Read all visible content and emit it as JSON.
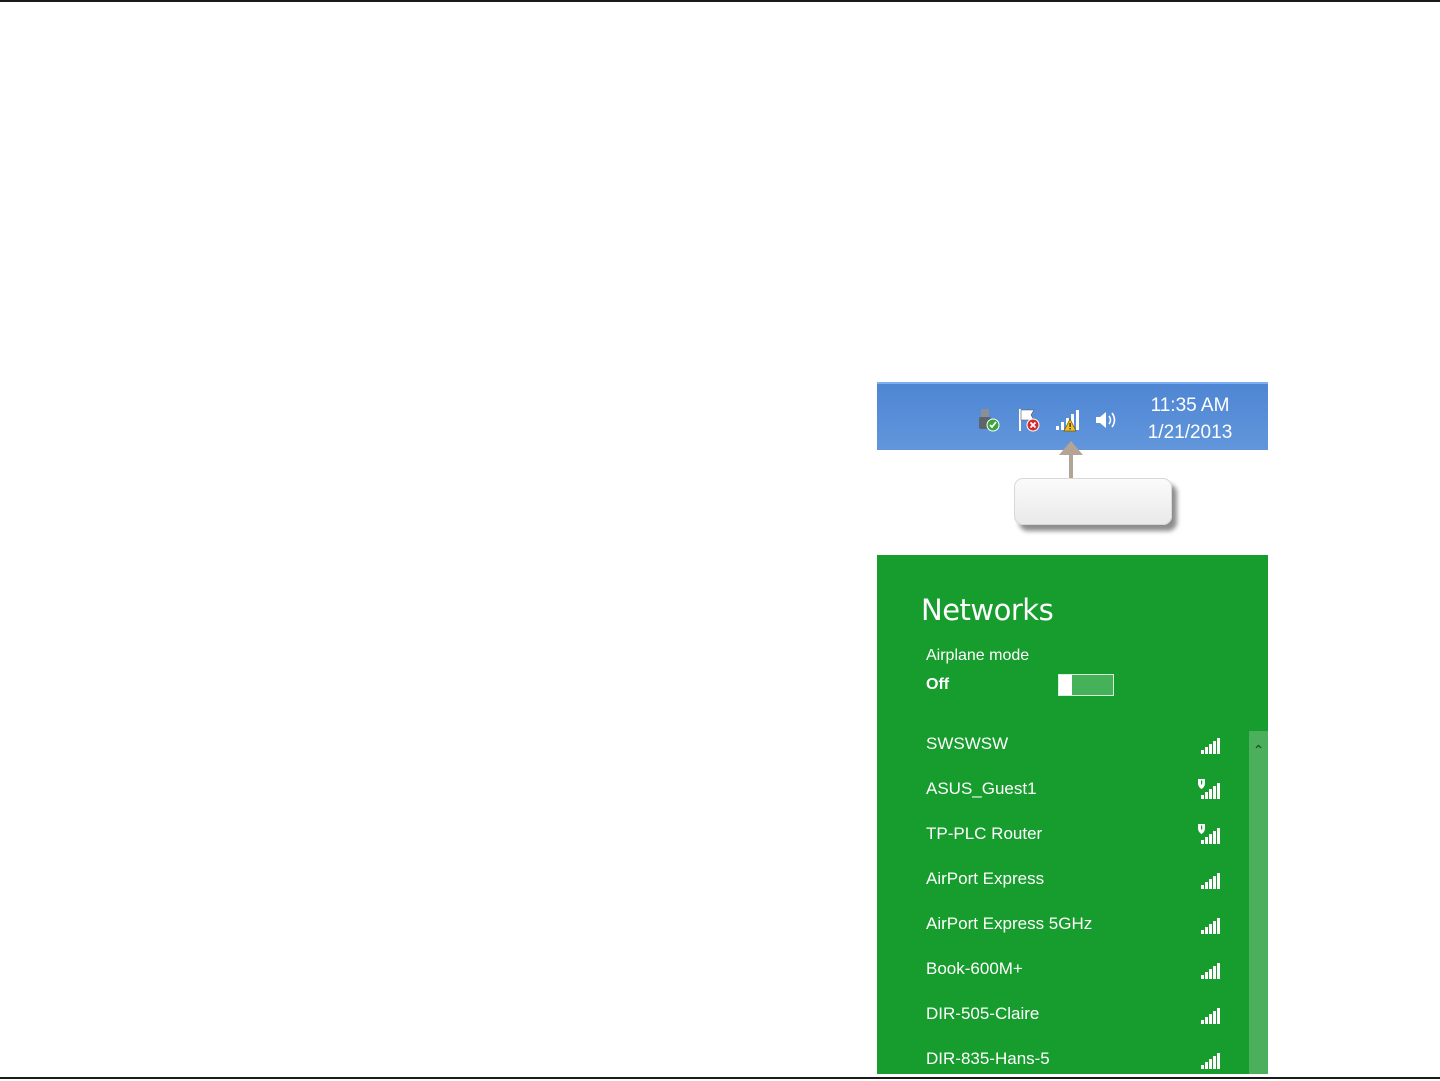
{
  "taskbar": {
    "time": "11:35 AM",
    "date": "1/21/2013",
    "tray_icons": [
      "usb-safe-remove-icon",
      "action-center-flag-icon",
      "wireless-network-warning-icon",
      "speaker-volume-icon"
    ]
  },
  "colors": {
    "taskbar_blue": "#5b8fd6",
    "panel_green": "#179c2e",
    "callout_arrow": "#b3a496"
  },
  "networks_panel": {
    "title": "Networks",
    "airplane_mode_label": "Airplane mode",
    "airplane_mode_state": "Off",
    "networks": [
      {
        "name": "SWSWSW",
        "secured_shield": false
      },
      {
        "name": "ASUS_Guest1",
        "secured_shield": true
      },
      {
        "name": "TP-PLC Router",
        "secured_shield": true
      },
      {
        "name": "AirPort Express",
        "secured_shield": false
      },
      {
        "name": "AirPort Express 5GHz",
        "secured_shield": false
      },
      {
        "name": "Book-600M+",
        "secured_shield": false
      },
      {
        "name": "DIR-505-Claire",
        "secured_shield": false
      },
      {
        "name": "DIR-835-Hans-5",
        "secured_shield": false
      }
    ]
  }
}
